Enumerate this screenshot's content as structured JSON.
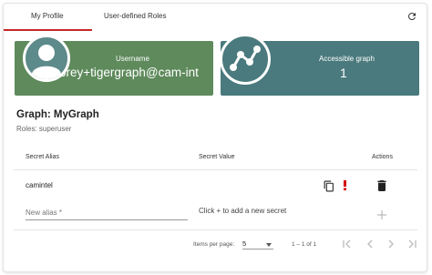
{
  "tabs": [
    {
      "label": "My Profile",
      "active": true
    },
    {
      "label": "User-defined Roles",
      "active": false
    }
  ],
  "cards": {
    "user": {
      "title": "Username",
      "value": "orey+tigergraph@cam-int",
      "color": "#5e8a5c"
    },
    "graph": {
      "title": "Accessible graph",
      "value": "1",
      "color": "#4a7a7d"
    }
  },
  "graph": {
    "heading": "Graph: MyGraph",
    "roles": "Roles: superuser"
  },
  "secrets_table": {
    "headers": {
      "alias": "Secret Alias",
      "value": "Secret Value",
      "actions": "Actions"
    },
    "rows": [
      {
        "alias": "camintel"
      }
    ],
    "new_alias_placeholder": "New alias *",
    "add_hint": "Click + to add a new secret"
  },
  "paginator": {
    "items_per_page_label": "Items per page:",
    "items_per_page_value": "5",
    "range_label": "1 – 1 of 1"
  },
  "colors": {
    "accent": "#c62828",
    "warning": "#d50000"
  },
  "icons": [
    "refresh-icon",
    "user-avatar-icon",
    "graph-icon",
    "copy-icon",
    "warning-icon",
    "delete-icon",
    "add-icon",
    "first-page-icon",
    "previous-page-icon",
    "next-page-icon",
    "last-page-icon"
  ]
}
